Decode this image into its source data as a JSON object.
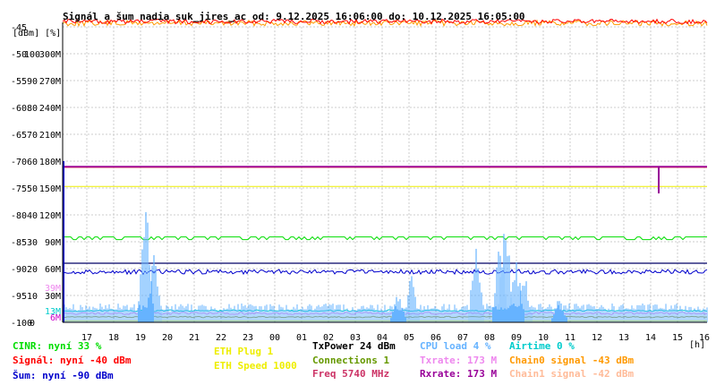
{
  "title": "Signál a šum nadia suk_jires_ac od: 9.12.2025 16:06:00 do: 10.12.2025 16:05:00",
  "units_label": "[dBm] [%]",
  "x_unit_label": "[h]",
  "colors": {
    "signal": "#ff0000",
    "noise": "#0000cc",
    "cinr": "#00dd00",
    "cpu": "#66b3ff",
    "airtime": "#00cccc",
    "chain0": "#ff9900",
    "txrate": "#ee88ee",
    "rxrate": "#990099",
    "txpower": "#000000",
    "eth_plug": "#eeee00",
    "freq": "#cc3366",
    "connections": "#669900",
    "chain1": "#ffbb99",
    "grid": "#cccccc",
    "axis": "#000000"
  },
  "chart_data": {
    "type": "line",
    "title": "Signál a šum nadia suk_jires_ac od: 9.12.2025 16:06:00 do: 10.12.2025 16:05:00",
    "x_tick_labels": [
      "17",
      "18",
      "19",
      "20",
      "21",
      "22",
      "23",
      "00",
      "01",
      "02",
      "03",
      "04",
      "05",
      "06",
      "07",
      "08",
      "09",
      "10",
      "11",
      "12",
      "13",
      "14",
      "15",
      "16"
    ],
    "y_ticks": [
      {
        "dbm": "-45",
        "pct": "",
        "rate": ""
      },
      {
        "dbm": "-50",
        "pct": "100",
        "rate": "300M"
      },
      {
        "dbm": "-55",
        "pct": "90",
        "rate": "270M"
      },
      {
        "dbm": "-60",
        "pct": "80",
        "rate": "240M"
      },
      {
        "dbm": "-65",
        "pct": "70",
        "rate": "210M"
      },
      {
        "dbm": "-70",
        "pct": "60",
        "rate": "180M"
      },
      {
        "dbm": "-75",
        "pct": "50",
        "rate": "150M"
      },
      {
        "dbm": "-80",
        "pct": "40",
        "rate": "120M"
      },
      {
        "dbm": "-85",
        "pct": "30",
        "rate": "90M"
      },
      {
        "dbm": "-90",
        "pct": "20",
        "rate": "60M"
      },
      {
        "dbm": "-95",
        "pct": "10",
        "rate": "30M"
      },
      {
        "dbm": "-100",
        "pct": "0",
        "rate": ""
      }
    ],
    "ylim_dbm": [
      -100,
      -45
    ],
    "xlim_hours": [
      16.1,
      40.1
    ],
    "extra_rate_labels": [
      {
        "text": "39M",
        "value_mbps": 39,
        "color": "#ee88ee"
      },
      {
        "text": "13M",
        "value_mbps": 13,
        "color": "#00cccc"
      },
      {
        "text": "6M",
        "value_mbps": 6,
        "color": "#cc00cc"
      }
    ],
    "series": [
      {
        "key": "signal",
        "unit": "dBm",
        "values_approx": [
          -40,
          -44
        ],
        "note_value": -40
      },
      {
        "key": "chain0",
        "unit": "dBm",
        "values_approx": [
          -43,
          -46
        ],
        "note_value": -43
      },
      {
        "key": "noise",
        "unit": "dBm",
        "values_approx": [
          -90,
          -91
        ],
        "note_value": -90
      },
      {
        "key": "cinr",
        "unit": "%",
        "values_approx": [
          31,
          33
        ],
        "note_value": 33
      },
      {
        "key": "txpower",
        "unit": "dBm",
        "constant": 24
      },
      {
        "key": "freq",
        "unit": "MHz",
        "constant": 5740
      },
      {
        "key": "txrate",
        "unit": "Mbps",
        "constant": 173
      },
      {
        "key": "rxrate",
        "unit": "Mbps",
        "constant": 173
      },
      {
        "key": "eth_speed",
        "unit": "Mbps",
        "constant": 1000
      },
      {
        "key": "cpu",
        "unit": "%",
        "baseline": 4,
        "spikes": [
          {
            "hour": 19.2,
            "pct": 48
          },
          {
            "hour": 19.5,
            "pct": 28
          },
          {
            "hour": 28.6,
            "pct": 12
          },
          {
            "hour": 29.1,
            "pct": 20
          },
          {
            "hour": 31.5,
            "pct": 35
          },
          {
            "hour": 32.4,
            "pct": 40
          },
          {
            "hour": 32.6,
            "pct": 45
          },
          {
            "hour": 33.0,
            "pct": 25
          },
          {
            "hour": 33.3,
            "pct": 22
          },
          {
            "hour": 34.6,
            "pct": 10
          }
        ]
      },
      {
        "key": "airtime",
        "unit": "%",
        "baseline": 0
      }
    ]
  },
  "legend": {
    "cinr": "CINR: nyní 33 %",
    "signal": "Signál: nyní -40 dBm",
    "noise": "Šum: nyní -90 dBm",
    "eth_plug": "ETH Plug 1",
    "eth_speed": "ETH Speed 1000",
    "txpower": "TxPower 24 dBm",
    "connections": "Connections 1",
    "freq": "Freq 5740 MHz",
    "cpu": "CPU load 4 %",
    "txrate": "Txrate: 173 M",
    "rxrate": "Rxrate: 173 M",
    "airtime": "Airtime 0 %",
    "chain0": "Chain0 signal -43 dBm",
    "chain1": "Chain1 signal -42 dBm"
  }
}
